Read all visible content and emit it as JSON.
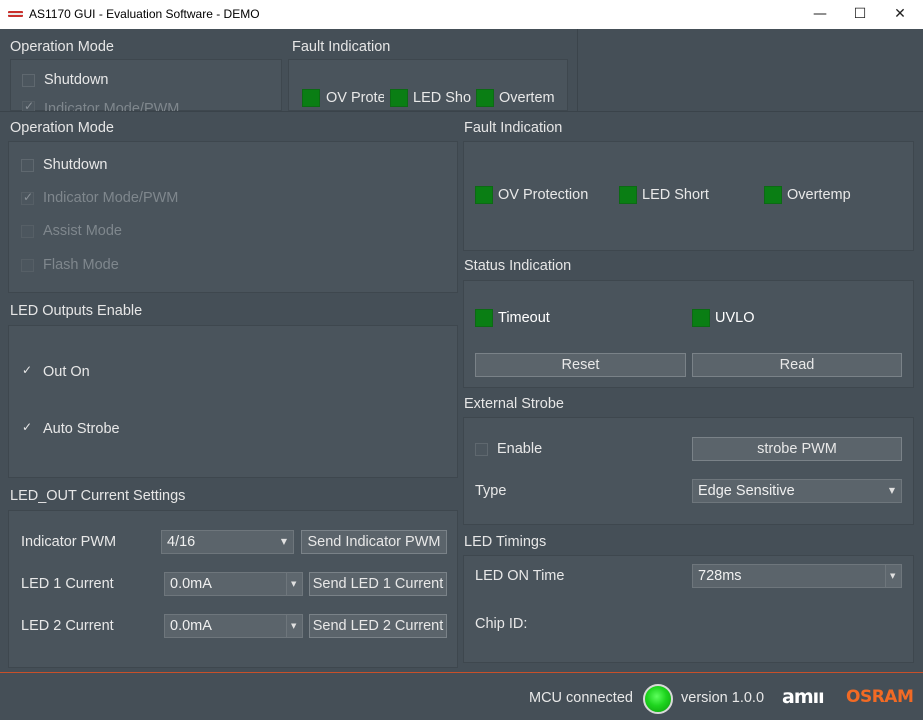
{
  "window": {
    "title": "AS1170 GUI - Evaluation Software - DEMO",
    "minimize_glyph": "—",
    "maximize_glyph": "☐",
    "close_glyph": "✕"
  },
  "overlay": {
    "operation_mode": {
      "title": "Operation Mode",
      "shutdown": "Shutdown",
      "indicator": "Indicator Mode/PWM"
    },
    "fault": {
      "title": "Fault Indication",
      "ov": "OV Prote",
      "led_short": "LED Sho",
      "overtemp": "Overtem"
    }
  },
  "operation_mode": {
    "title": "Operation Mode",
    "items": [
      {
        "label": "Shutdown",
        "checked": false,
        "enabled": true
      },
      {
        "label": "Indicator Mode/PWM",
        "checked": true,
        "enabled": false
      },
      {
        "label": "Assist Mode",
        "checked": false,
        "enabled": false
      },
      {
        "label": "Flash Mode",
        "checked": false,
        "enabled": false
      }
    ]
  },
  "led_outputs": {
    "title": "LED Outputs Enable",
    "out_on": "Out On",
    "auto_strobe": "Auto Strobe"
  },
  "current_settings": {
    "title": "LED_OUT Current Settings",
    "indicator_label": "Indicator PWM",
    "indicator_value": "4/16",
    "indicator_button": "Send Indicator PWM",
    "led1_label": "LED 1 Current",
    "led1_value": "0.0mA",
    "led1_button": "Send LED 1 Current",
    "led2_label": "LED 2 Current",
    "led2_value": "0.0mA",
    "led2_button": "Send LED 2 Current"
  },
  "fault": {
    "title": "Fault Indication",
    "ov": "OV Protection",
    "led_short": "LED Short",
    "overtemp": "Overtemp"
  },
  "status": {
    "title": "Status Indication",
    "timeout": "Timeout",
    "uvlo": "UVLO",
    "reset": "Reset",
    "read": "Read"
  },
  "external_strobe": {
    "title": "External Strobe",
    "enable": "Enable",
    "strobe_button": "strobe PWM",
    "type_label": "Type",
    "type_value": "Edge Sensitive"
  },
  "timings": {
    "title": "LED Timings",
    "on_time_label": "LED ON Time",
    "on_time_value": "728ms",
    "chip_id_label": "Chip ID:"
  },
  "footer": {
    "mcu_status": "MCU connected",
    "version": "version 1.0.0",
    "ams": "amıı",
    "osram": "OSRAM"
  },
  "colors": {
    "background": "#454f57",
    "led_green": "#0a7e14",
    "osram_orange": "#f26a24"
  }
}
